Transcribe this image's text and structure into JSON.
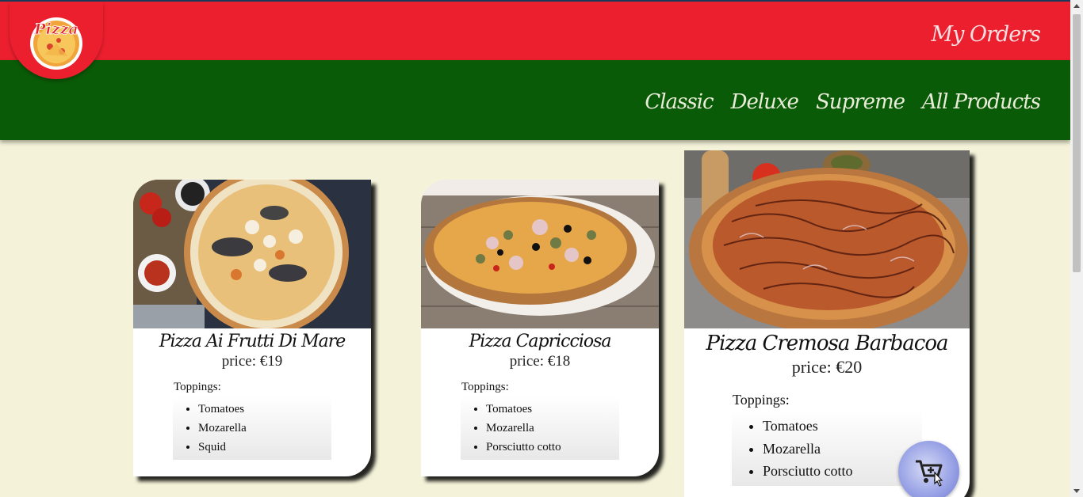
{
  "header": {
    "logo_text": "Pizza",
    "my_orders": "My Orders",
    "nav": [
      "Classic",
      "Deluxe",
      "Supreme",
      "All Products"
    ]
  },
  "products": [
    {
      "name": "Pizza Ai Frutti Di Mare",
      "price": "price: €19",
      "toppings_label": "Toppings:",
      "toppings": [
        "Tomatoes",
        "Mozarella",
        "Squid"
      ]
    },
    {
      "name": "Pizza Capricciosa",
      "price": "price: €18",
      "toppings_label": "Toppings:",
      "toppings": [
        "Tomatoes",
        "Mozarella",
        "Porsciutto cotto"
      ]
    },
    {
      "name": "Pizza Cremosa Barbacoa",
      "price": "price: €20",
      "toppings_label": "Toppings:",
      "toppings": [
        "Tomatoes",
        "Mozarella",
        "Porsciutto cotto"
      ]
    }
  ],
  "cart_button": {
    "icon": "add-to-cart-icon"
  },
  "colors": {
    "top_bar": "#ec1f2e",
    "nav_bar": "#0a5b08",
    "page_bg": "#f4f2d8"
  }
}
